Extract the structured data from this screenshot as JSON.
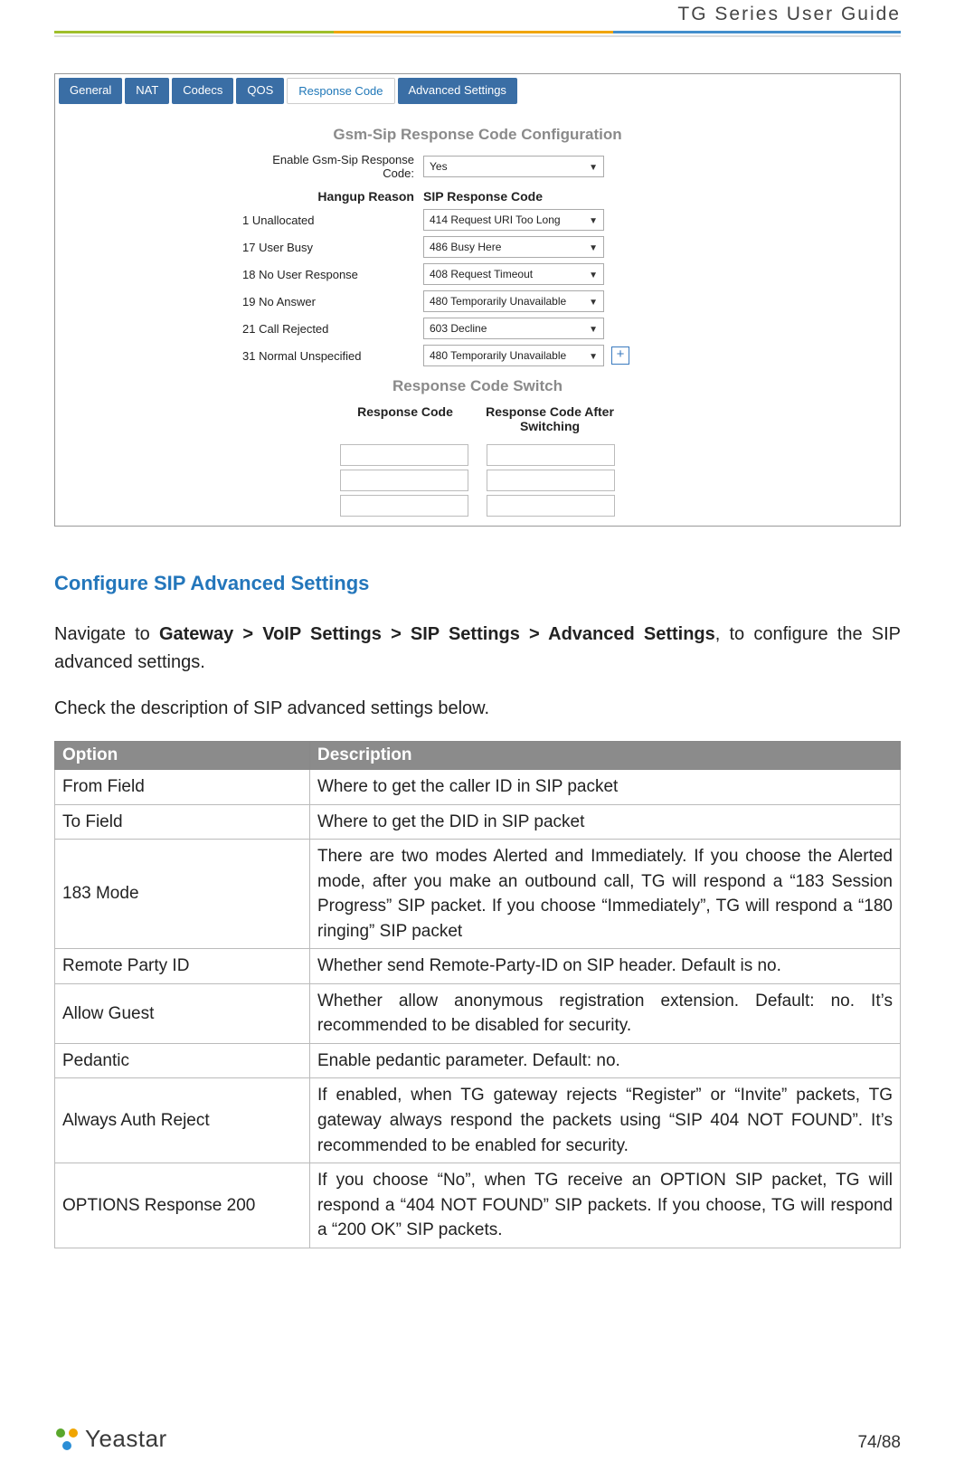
{
  "header": {
    "title": "TG Series User Guide"
  },
  "screenshot": {
    "tabs": [
      "General",
      "NAT",
      "Codecs",
      "QOS",
      "Response Code",
      "Advanced Settings"
    ],
    "active_tab_index": 4,
    "section1_title": "Gsm-Sip Response Code Configuration",
    "enable_label": "Enable Gsm-Sip Response Code:",
    "enable_value": "Yes",
    "header_reason": "Hangup Reason",
    "header_code": "SIP Response Code",
    "rows": [
      {
        "reason": "1 Unallocated",
        "code": "414 Request URI Too Long"
      },
      {
        "reason": "17 User Busy",
        "code": "486 Busy Here"
      },
      {
        "reason": "18 No User Response",
        "code": "408 Request Timeout"
      },
      {
        "reason": "19 No Answer",
        "code": "480 Temporarily Unavailable"
      },
      {
        "reason": "21 Call Rejected",
        "code": "603 Decline"
      },
      {
        "reason": "31 Normal Unspecified",
        "code": "480 Temporarily Unavailable"
      }
    ],
    "plus_label": "+",
    "section2_title": "Response Code Switch",
    "switch_header_left": "Response Code",
    "switch_header_right": "Response Code After Switching",
    "switch_rows": 3
  },
  "article": {
    "heading": "Configure SIP Advanced Settings",
    "nav_pre": "Navigate to ",
    "nav_path": "Gateway > VoIP Settings > SIP Settings > Advanced Settings",
    "nav_post": ", to configure the SIP advanced settings.",
    "check_line": "Check the description of SIP advanced settings below."
  },
  "table": {
    "header_option": "Option",
    "header_desc": "Description",
    "rows": [
      {
        "option": "From Field",
        "desc": "Where to get the caller ID in SIP packet"
      },
      {
        "option": "To Field",
        "desc": "Where to get the DID in SIP packet"
      },
      {
        "option": "183 Mode",
        "desc": "There are two modes Alerted and Immediately. If you choose the Alerted mode, after you make an outbound call, TG will respond a “183 Session Progress” SIP packet. If you choose “Immediately”, TG will respond a “180 ringing” SIP packet"
      },
      {
        "option": "Remote Party ID",
        "desc": "Whether send Remote-Party-ID on SIP header. Default is no."
      },
      {
        "option": "Allow Guest",
        "desc": "Whether allow anonymous registration extension. Default: no. It’s recommended to be disabled for security."
      },
      {
        "option": "Pedantic",
        "desc": "Enable pedantic parameter. Default: no."
      },
      {
        "option": "Always Auth Reject",
        "desc": "If enabled, when TG gateway rejects “Register” or “Invite” packets, TG gateway always respond the packets using “SIP 404 NOT FOUND”. It’s recommended to be enabled for security."
      },
      {
        "option": "OPTIONS Response 200",
        "desc": "If you choose “No”, when TG receive an OPTION SIP packet, TG will respond a “404 NOT FOUND” SIP packets. If you choose, TG will respond a “200 OK” SIP packets."
      }
    ]
  },
  "footer": {
    "brand": "Yeastar",
    "page": "74/88"
  }
}
